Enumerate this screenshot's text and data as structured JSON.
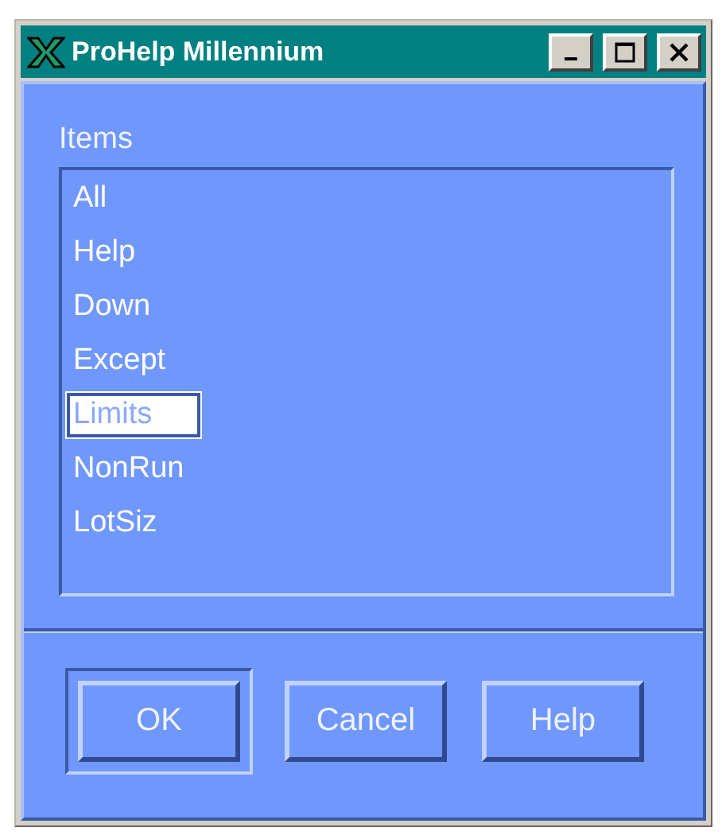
{
  "window": {
    "title": "ProHelp Millennium"
  },
  "list_label": "Items",
  "items": [
    {
      "label": "All",
      "selected": false
    },
    {
      "label": "Help",
      "selected": false
    },
    {
      "label": "Down",
      "selected": false
    },
    {
      "label": "Except",
      "selected": false
    },
    {
      "label": "Limits",
      "selected": true
    },
    {
      "label": "NonRun",
      "selected": false
    },
    {
      "label": "LotSiz",
      "selected": false
    }
  ],
  "buttons": [
    {
      "label": "OK",
      "default": true
    },
    {
      "label": "Cancel",
      "default": false
    },
    {
      "label": "Help",
      "default": false
    }
  ]
}
